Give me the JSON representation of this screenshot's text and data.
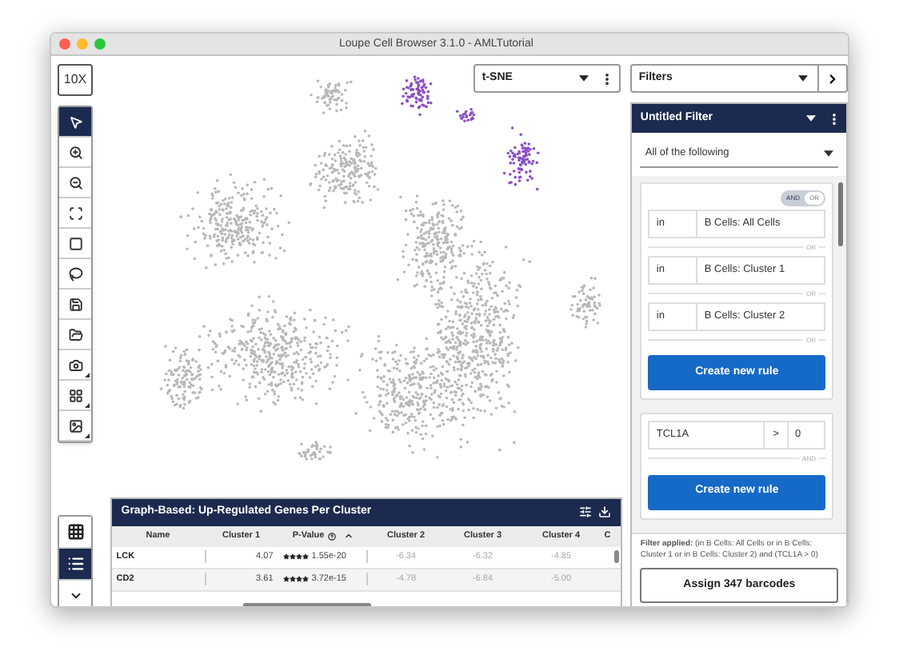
{
  "window": {
    "title": "Loupe Cell Browser 3.1.0 - AMLTutorial"
  },
  "logo": {
    "text": "10X"
  },
  "toolbar": {
    "tools": [
      {
        "selected": true
      },
      {
        "selected": false
      },
      {
        "selected": false
      },
      {
        "selected": false
      },
      {
        "selected": false
      },
      {
        "selected": false
      },
      {
        "selected": false
      },
      {
        "selected": false
      },
      {
        "selected": false
      },
      {
        "selected": false
      },
      {
        "selected": false
      }
    ]
  },
  "view_buttons": [
    {
      "selected": false
    },
    {
      "selected": true
    }
  ],
  "projection": {
    "value": "t-SNE"
  },
  "table": {
    "title": "Graph-Based: Up-Regulated Genes Per Cluster",
    "columns": [
      "Name",
      "Cluster 1",
      "P-Value",
      "Cluster 2",
      "Cluster 3",
      "Cluster 4",
      "C"
    ],
    "rows": [
      {
        "name": "LCK",
        "cluster_1": "4.07",
        "stars": 4,
        "p_value": "1.55e-20",
        "cluster_2": "-6.34",
        "cluster_3": "-6.32",
        "cluster_4": "-4.85"
      },
      {
        "name": "CD2",
        "cluster_1": "3.61",
        "stars": 4,
        "p_value": "3.72e-15",
        "cluster_2": "-4.78",
        "cluster_3": "-6.84",
        "cluster_4": "-5.00"
      }
    ]
  },
  "filters": {
    "value": "Filters"
  },
  "filter": {
    "title": "Untitled Filter",
    "match": "All of the following",
    "groups": [
      {
        "toggle": [
          {
            "label": "AND",
            "selected": false
          },
          {
            "label": "OR",
            "selected": true
          }
        ],
        "button": "Create new rule",
        "rules": [
          {
            "kind": "membership",
            "operator": "in",
            "value": "B Cells: All Cells",
            "separator": "OR"
          },
          {
            "kind": "membership",
            "operator": "in",
            "value": "B Cells: Cluster 1",
            "separator": "OR"
          },
          {
            "kind": "membership",
            "operator": "in",
            "value": "B Cells: Cluster 2",
            "separator": "OR"
          }
        ]
      },
      {
        "button": "Create new rule",
        "rules": [
          {
            "kind": "expression",
            "feature": "TCL1A",
            "operator": ">",
            "value": "0",
            "separator": "AND"
          }
        ]
      }
    ],
    "summary": "**Filter applied:** (in B Cells: All Cells or in B Cells: Cluster 1 or in B Cells: Cluster 2) and (TCL1A > 0)",
    "assign_button": "Assign 347 barcodes"
  }
}
